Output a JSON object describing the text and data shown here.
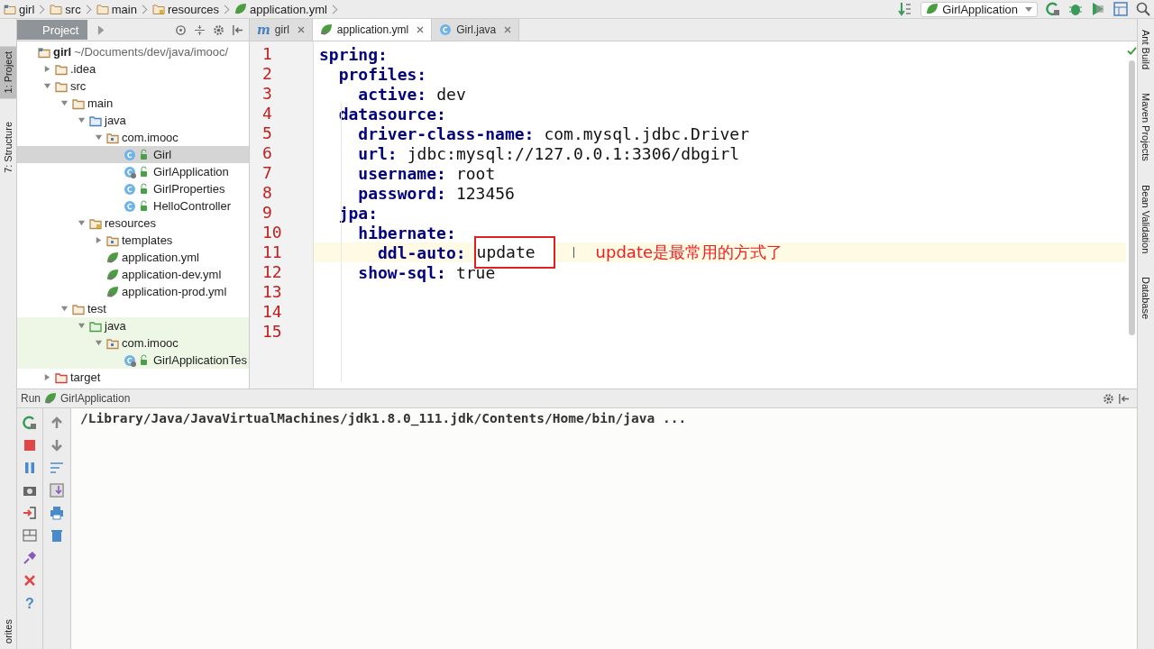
{
  "breadcrumbs": [
    {
      "label": "girl",
      "kind": "project"
    },
    {
      "label": "src",
      "kind": "folder"
    },
    {
      "label": "main",
      "kind": "folder"
    },
    {
      "label": "resources",
      "kind": "resources"
    },
    {
      "label": "application.yml",
      "kind": "spring"
    }
  ],
  "run_config": {
    "label": "GirlApplication"
  },
  "left_stripe": [
    {
      "label": "1: Project",
      "selected": true
    },
    {
      "label": "7: Structure",
      "selected": false
    },
    {
      "label": "orites",
      "selected": false
    }
  ],
  "project_panel": {
    "title": "Project"
  },
  "tabs": [
    {
      "label": "girl",
      "kind": "maven",
      "glyph": "m",
      "selected": false
    },
    {
      "label": "application.yml",
      "kind": "spring",
      "selected": true
    },
    {
      "label": "Girl.java",
      "kind": "class",
      "selected": false
    }
  ],
  "tree": [
    {
      "label": "girl",
      "path": "~/Documents/dev/java/imooc/",
      "kind": "project",
      "children": [
        {
          "label": ".idea",
          "kind": "folder",
          "expanded": false
        },
        {
          "label": "src",
          "kind": "folder",
          "expanded": true,
          "children": [
            {
              "label": "main",
              "kind": "folder",
              "expanded": true,
              "children": [
                {
                  "label": "java",
                  "kind": "source",
                  "expanded": true,
                  "children": [
                    {
                      "label": "com.imooc",
                      "kind": "package",
                      "expanded": true,
                      "children": [
                        {
                          "label": "Girl",
                          "kind": "class",
                          "selected": true
                        },
                        {
                          "label": "GirlApplication",
                          "kind": "app",
                          "selected": false
                        },
                        {
                          "label": "GirlProperties",
                          "kind": "class",
                          "selected": false
                        },
                        {
                          "label": "HelloController",
                          "kind": "class",
                          "selected": false
                        }
                      ]
                    }
                  ]
                },
                {
                  "label": "resources",
                  "kind": "resources",
                  "expanded": true,
                  "children": [
                    {
                      "label": "templates",
                      "kind": "package",
                      "expanded": false
                    },
                    {
                      "label": "application.yml",
                      "kind": "spring",
                      "selected": false
                    },
                    {
                      "label": "application-dev.yml",
                      "kind": "spring",
                      "selected": false
                    },
                    {
                      "label": "application-prod.yml",
                      "kind": "spring",
                      "selected": false
                    }
                  ]
                }
              ]
            },
            {
              "label": "test",
              "kind": "folder",
              "expanded": true,
              "children": [
                {
                  "label": "java",
                  "kind": "test",
                  "expanded": true,
                  "children": [
                    {
                      "label": "com.imooc",
                      "kind": "package",
                      "expanded": true,
                      "children": [
                        {
                          "label": "GirlApplicationTes",
                          "kind": "app",
                          "selected": false
                        }
                      ]
                    }
                  ]
                }
              ]
            }
          ]
        },
        {
          "label": "target",
          "kind": "excluded",
          "expanded": false
        }
      ]
    }
  ],
  "editor_lines": [
    {
      "number": "1",
      "key": "spring:"
    },
    {
      "number": "2",
      "key": "  profiles:"
    },
    {
      "number": "3",
      "key": "    active:",
      "value": "dev"
    },
    {
      "number": "4",
      "key": "  datasource:"
    },
    {
      "number": "5",
      "key": "    driver-class-name:",
      "value": "com.mysql.jdbc.Driver"
    },
    {
      "number": "6",
      "key": "    url:",
      "value": "jdbc:mysql://127.0.0.1:3306/dbgirl"
    },
    {
      "number": "7",
      "key": "    username:",
      "value": "root"
    },
    {
      "number": "8",
      "key": "    password:",
      "value": "123456"
    },
    {
      "number": "9",
      "key": "  jpa:"
    },
    {
      "number": "10",
      "key": "    hibernate:"
    },
    {
      "number": "11",
      "key": "      ddl-auto:",
      "value": "update",
      "current": true,
      "boxed": true
    },
    {
      "number": "12",
      "key": "    show-sql:",
      "value": "true"
    },
    {
      "number": "13"
    },
    {
      "number": "14"
    },
    {
      "number": "15"
    }
  ],
  "annotation": {
    "text": "update是最常用的方式了"
  },
  "run_panel": {
    "title": "Run",
    "config": "GirlApplication",
    "help_glyph": "?",
    "output": "/Library/Java/JavaVirtualMachines/jdk1.8.0_111.jdk/Contents/Home/bin/java ..."
  },
  "right_stripe": [
    {
      "label": "Ant Build"
    },
    {
      "label": "Maven Projects"
    },
    {
      "label": "Bean Validation"
    },
    {
      "label": "Database"
    }
  ]
}
